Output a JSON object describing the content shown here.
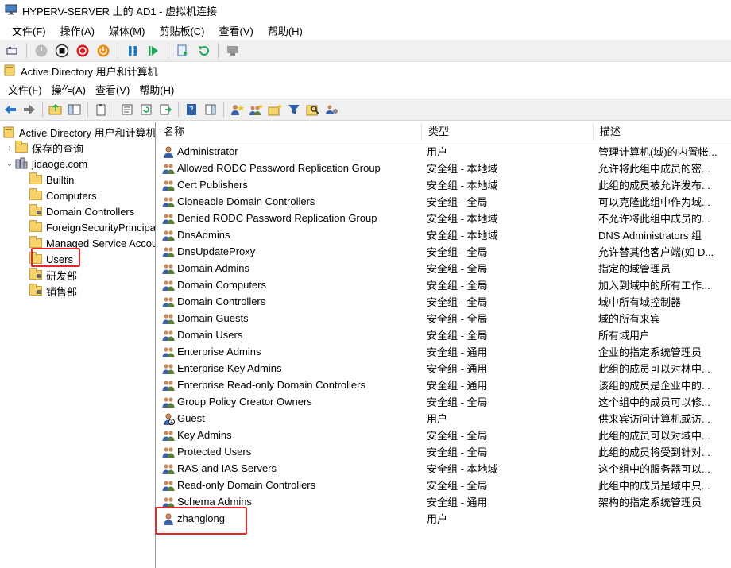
{
  "window": {
    "title": "HYPERV-SERVER 上的 AD1 - 虚拟机连接"
  },
  "vm_menu": [
    "文件(F)",
    "操作(A)",
    "媒体(M)",
    "剪贴板(C)",
    "查看(V)",
    "帮助(H)"
  ],
  "mmc": {
    "title": "Active Directory 用户和计算机",
    "menu": [
      "文件(F)",
      "操作(A)",
      "查看(V)",
      "帮助(H)"
    ]
  },
  "tree": {
    "root": "Active Directory 用户和计算机",
    "saved_queries": "保存的查询",
    "domain": "jidaoge.com",
    "children": [
      "Builtin",
      "Computers",
      "Domain Controllers",
      "ForeignSecurityPrincipals",
      "Managed Service Accounts",
      "Users",
      "研发部",
      "销售部"
    ]
  },
  "list": {
    "columns": [
      "名称",
      "类型",
      "描述"
    ],
    "rows": [
      {
        "name": "Administrator",
        "type": "用户",
        "desc": "管理计算机(域)的内置帐...",
        "icon": "user"
      },
      {
        "name": "Allowed RODC Password Replication Group",
        "type": "安全组 - 本地域",
        "desc": "允许将此组中成员的密...",
        "icon": "group"
      },
      {
        "name": "Cert Publishers",
        "type": "安全组 - 本地域",
        "desc": "此组的成员被允许发布...",
        "icon": "group"
      },
      {
        "name": "Cloneable Domain Controllers",
        "type": "安全组 - 全局",
        "desc": "可以克隆此组中作为域...",
        "icon": "group"
      },
      {
        "name": "Denied RODC Password Replication Group",
        "type": "安全组 - 本地域",
        "desc": "不允许将此组中成员的...",
        "icon": "group"
      },
      {
        "name": "DnsAdmins",
        "type": "安全组 - 本地域",
        "desc": "DNS Administrators 组",
        "icon": "group"
      },
      {
        "name": "DnsUpdateProxy",
        "type": "安全组 - 全局",
        "desc": "允许替其他客户端(如 D...",
        "icon": "group"
      },
      {
        "name": "Domain Admins",
        "type": "安全组 - 全局",
        "desc": "指定的域管理员",
        "icon": "group"
      },
      {
        "name": "Domain Computers",
        "type": "安全组 - 全局",
        "desc": "加入到域中的所有工作...",
        "icon": "group"
      },
      {
        "name": "Domain Controllers",
        "type": "安全组 - 全局",
        "desc": "域中所有域控制器",
        "icon": "group"
      },
      {
        "name": "Domain Guests",
        "type": "安全组 - 全局",
        "desc": "域的所有来宾",
        "icon": "group"
      },
      {
        "name": "Domain Users",
        "type": "安全组 - 全局",
        "desc": "所有域用户",
        "icon": "group"
      },
      {
        "name": "Enterprise Admins",
        "type": "安全组 - 通用",
        "desc": "企业的指定系统管理员",
        "icon": "group"
      },
      {
        "name": "Enterprise Key Admins",
        "type": "安全组 - 通用",
        "desc": "此组的成员可以对林中...",
        "icon": "group"
      },
      {
        "name": "Enterprise Read-only Domain Controllers",
        "type": "安全组 - 通用",
        "desc": "该组的成员是企业中的...",
        "icon": "group"
      },
      {
        "name": "Group Policy Creator Owners",
        "type": "安全组 - 全局",
        "desc": "这个组中的成员可以修...",
        "icon": "group"
      },
      {
        "name": "Guest",
        "type": "用户",
        "desc": "供来宾访问计算机或访...",
        "icon": "user-disabled"
      },
      {
        "name": "Key Admins",
        "type": "安全组 - 全局",
        "desc": "此组的成员可以对域中...",
        "icon": "group"
      },
      {
        "name": "Protected Users",
        "type": "安全组 - 全局",
        "desc": "此组的成员将受到针对...",
        "icon": "group"
      },
      {
        "name": "RAS and IAS Servers",
        "type": "安全组 - 本地域",
        "desc": "这个组中的服务器可以...",
        "icon": "group"
      },
      {
        "name": "Read-only Domain Controllers",
        "type": "安全组 - 全局",
        "desc": "此组中的成员是域中只...",
        "icon": "group"
      },
      {
        "name": "Schema Admins",
        "type": "安全组 - 通用",
        "desc": "架构的指定系统管理员",
        "icon": "group"
      },
      {
        "name": "zhanglong",
        "type": "用户",
        "desc": "",
        "icon": "user"
      }
    ]
  }
}
